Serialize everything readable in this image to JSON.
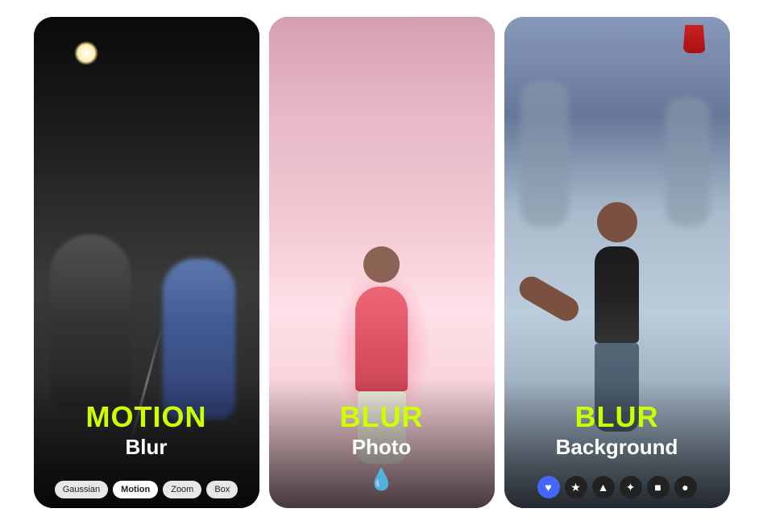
{
  "cards": [
    {
      "id": "card-motion-blur",
      "title_highlight": "MOTION",
      "title_normal": "",
      "subtitle": "Blur",
      "controls": [
        "Gaussian",
        "Motion",
        "Zoom",
        "Box"
      ],
      "active_control": "Motion",
      "bottom_type": "pills"
    },
    {
      "id": "card-blur-photo",
      "title_highlight": "BLUR",
      "title_normal": "",
      "subtitle": "Photo",
      "bottom_type": "waterdrop"
    },
    {
      "id": "card-blur-background",
      "title_highlight": "BLUR",
      "title_normal": "",
      "subtitle": "Background",
      "bottom_type": "icons",
      "icons": [
        "♥",
        "★",
        "▲",
        "✦",
        "■",
        "●"
      ]
    }
  ],
  "colors": {
    "highlight": "#ccff00",
    "white": "#ffffff",
    "icon_heart_bg": "#4466ff"
  }
}
